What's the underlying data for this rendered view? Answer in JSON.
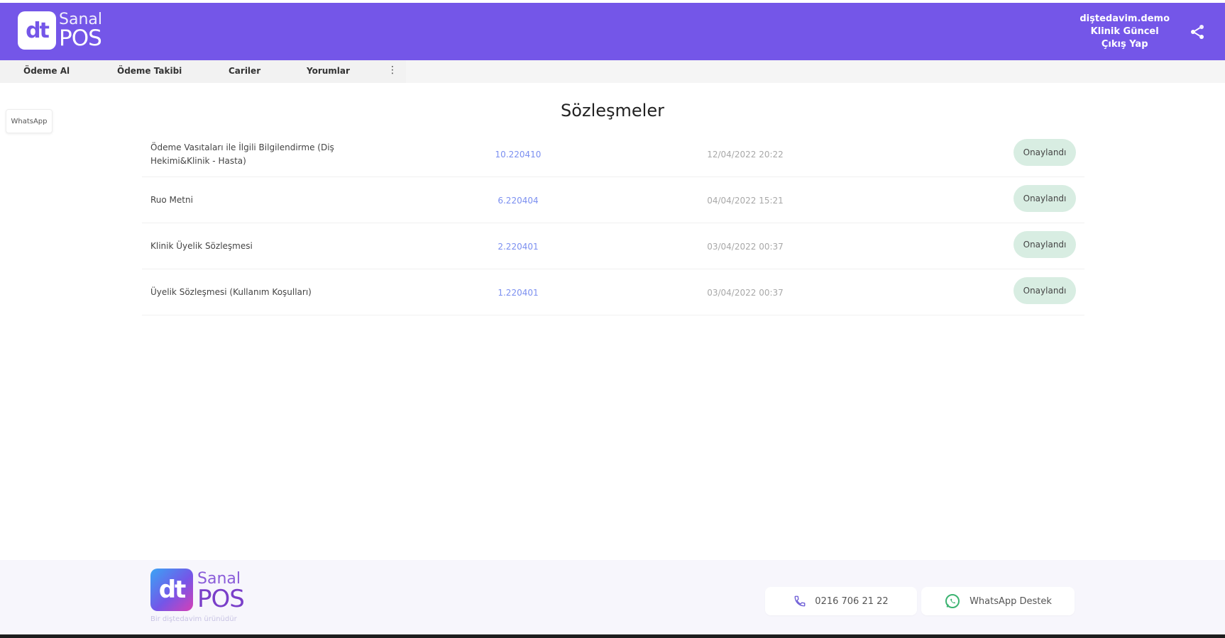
{
  "header": {
    "logo_small": "dt",
    "logo_line1": "Sanal",
    "logo_line2": "POS",
    "user": {
      "username": "diştedavim.demo",
      "clinic": "Klinik Güncel",
      "logout": "Çıkış Yap"
    },
    "share_icon": "share-icon"
  },
  "nav": {
    "tabs": [
      "Ödeme Al",
      "Ödeme Takibi",
      "Cariler",
      "Yorumlar"
    ],
    "more_label": "⋮"
  },
  "side_chip": {
    "label": "WhatsApp"
  },
  "page_title": "Sözleşmeler",
  "contracts": [
    {
      "name": "Ödeme Vasıtaları ile İlgili Bilgilendirme (Diş Hekimi&Klinik - Hasta)",
      "version": "10.220410",
      "date": "12/04/2022 20:22",
      "status": "Onaylandı"
    },
    {
      "name": "Ruo Metni",
      "version": "6.220404",
      "date": "04/04/2022 15:21",
      "status": "Onaylandı"
    },
    {
      "name": "Klinik Üyelik Sözleşmesi",
      "version": "2.220401",
      "date": "03/04/2022 00:37",
      "status": "Onaylandı"
    },
    {
      "name": "Üyelik Sözleşmesi (Kullanım Koşulları)",
      "version": "1.220401",
      "date": "03/04/2022 00:37",
      "status": "Onaylandı"
    }
  ],
  "footer": {
    "logo_small": "dt",
    "logo_line1": "Sanal",
    "logo_line2": "POS",
    "tagline": "Bir diştedavim ürünüdür",
    "phone": "0216 706 21 22",
    "whatsapp": "WhatsApp Destek"
  },
  "colors": {
    "header_bg": "#7456e8",
    "badge_bg": "#d8ede2",
    "link": "#7b8ff0"
  }
}
